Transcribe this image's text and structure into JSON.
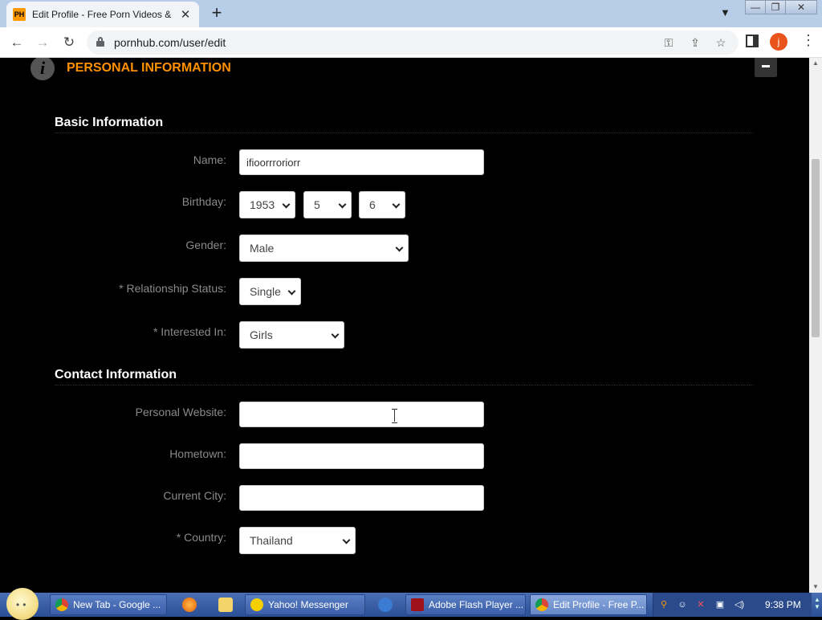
{
  "browser": {
    "tab_favicon": "PH",
    "tab_title": "Edit Profile - Free Porn Videos &",
    "tab_close": "✕",
    "new_tab": "+",
    "url": "pornhub.com/user/edit",
    "profile_initial": "j"
  },
  "page": {
    "section_title": "PERSONAL INFORMATION",
    "info_icon": "i",
    "basic_info_title": "Basic Information",
    "contact_info_title": "Contact Information",
    "fields": {
      "name": {
        "label": "Name:",
        "value": "ifioorrroriorr"
      },
      "birthday": {
        "label": "Birthday:",
        "year": "1953",
        "month": "5",
        "day": "6"
      },
      "gender": {
        "label": "Gender:",
        "value": "Male"
      },
      "relationship": {
        "label": "* Relationship Status:",
        "value": "Single"
      },
      "interested": {
        "label": "* Interested In:",
        "value": "Girls"
      },
      "website": {
        "label": "Personal Website:",
        "value": ""
      },
      "hometown": {
        "label": "Hometown:",
        "value": ""
      },
      "city": {
        "label": "Current City:",
        "value": ""
      },
      "country": {
        "label": "* Country:",
        "value": "Thailand"
      }
    }
  },
  "taskbar": {
    "items": [
      {
        "label": "New Tab - Google ..."
      },
      {
        "label": "Yahoo! Messenger"
      },
      {
        "label": "Adobe Flash Player ..."
      },
      {
        "label": "Edit Profile - Free P..."
      }
    ],
    "clock": "9:38 PM"
  },
  "colors": {
    "accent": "#ff9000",
    "page_bg": "#000000",
    "label": "#8a8a8a"
  }
}
